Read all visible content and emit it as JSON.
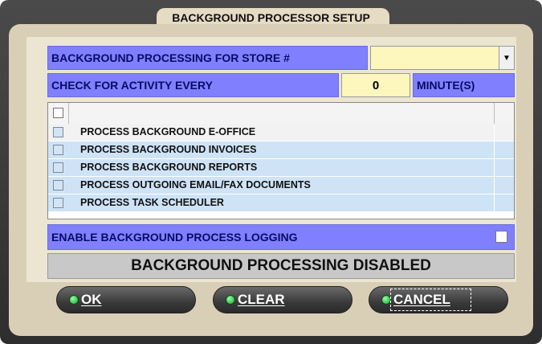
{
  "window": {
    "title": "BACKGROUND PROCESSOR SETUP"
  },
  "store_row": {
    "label": "BACKGROUND PROCESSING FOR STORE #",
    "selected": ""
  },
  "activity_row": {
    "label": "CHECK FOR ACTIVITY EVERY",
    "value": "0",
    "unit": "MINUTE(S)"
  },
  "tasks": [
    {
      "label": "PROCESS BACKGROUND E-OFFICE",
      "checked": false
    },
    {
      "label": "PROCESS BACKGROUND INVOICES",
      "checked": false
    },
    {
      "label": "PROCESS BACKGROUND REPORTS",
      "checked": false
    },
    {
      "label": "PROCESS OUTGOING EMAIL/FAX DOCUMENTS",
      "checked": false
    },
    {
      "label": "PROCESS TASK SCHEDULER",
      "checked": false
    }
  ],
  "logging": {
    "label": "ENABLE BACKGROUND PROCESS LOGGING",
    "checked": false
  },
  "status": {
    "text": "BACKGROUND PROCESSING DISABLED"
  },
  "buttons": {
    "ok": "OK",
    "clear": "CLEAR",
    "cancel": "CANCEL"
  },
  "colors": {
    "label_bg": "#8080ff",
    "input_bg": "#fdf7bd",
    "row_selected": "#f2f2f2",
    "row_normal": "#cfe3f7"
  }
}
